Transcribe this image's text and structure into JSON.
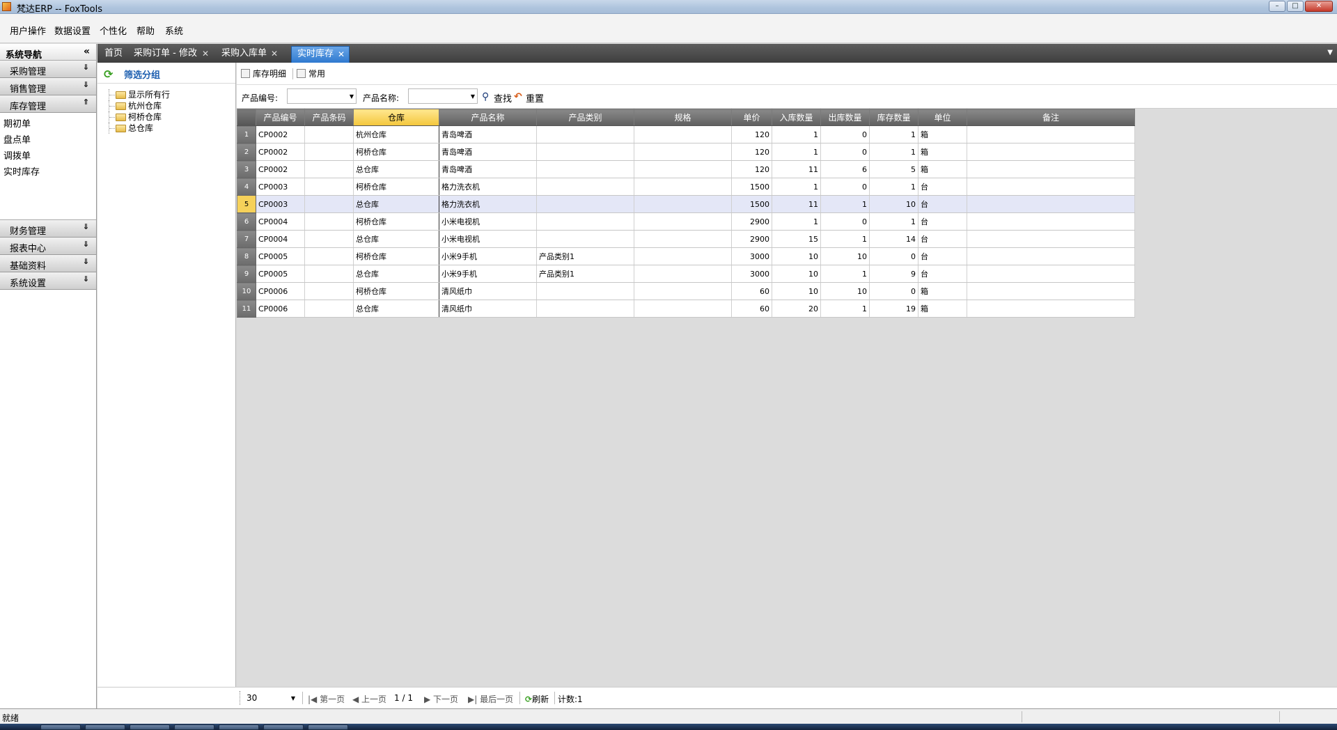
{
  "window": {
    "title": "梵达ERP -- FoxTools"
  },
  "menu": [
    "用户操作",
    "数据设置",
    "个性化",
    "帮助",
    "系统"
  ],
  "nav": {
    "header": "系统导航",
    "collapse_glyph": "«",
    "groups": [
      "采购管理",
      "销售管理",
      "库存管理"
    ],
    "sub_items": [
      "期初单",
      "盘点单",
      "调拨单",
      "实时库存"
    ],
    "groups_bottom": [
      "财务管理",
      "报表中心",
      "基础资料",
      "系统设置"
    ]
  },
  "tabs": [
    {
      "label": "首页"
    },
    {
      "label": "采购订单 - 修改"
    },
    {
      "label": "采购入库单"
    },
    {
      "label": "实时库存"
    }
  ],
  "filter": {
    "title": "筛选分组",
    "tree": [
      "显示所有行",
      "杭州仓库",
      "柯桥仓库",
      "总仓库"
    ],
    "footer_select": "常用"
  },
  "toolbar": {
    "detail": "库存明细",
    "common": "常用"
  },
  "search": {
    "code_label": "产品编号:",
    "name_label": "产品名称:",
    "search_btn": "查找",
    "reset_btn": "重置"
  },
  "grid": {
    "columns": [
      "产品编号",
      "产品条码",
      "仓库",
      "产品名称",
      "产品类别",
      "规格",
      "单价",
      "入库数量",
      "出库数量",
      "库存数量",
      "单位",
      "备注"
    ],
    "rows": [
      [
        "1",
        "CP0002",
        "",
        "杭州仓库",
        "青岛啤酒",
        "",
        "",
        "120",
        "1",
        "0",
        "1",
        "箱",
        ""
      ],
      [
        "2",
        "CP0002",
        "",
        "柯桥仓库",
        "青岛啤酒",
        "",
        "",
        "120",
        "1",
        "0",
        "1",
        "箱",
        ""
      ],
      [
        "3",
        "CP0002",
        "",
        "总仓库",
        "青岛啤酒",
        "",
        "",
        "120",
        "11",
        "6",
        "5",
        "箱",
        ""
      ],
      [
        "4",
        "CP0003",
        "",
        "柯桥仓库",
        "格力洗衣机",
        "",
        "",
        "1500",
        "1",
        "0",
        "1",
        "台",
        ""
      ],
      [
        "5",
        "CP0003",
        "",
        "总仓库",
        "格力洗衣机",
        "",
        "",
        "1500",
        "11",
        "1",
        "10",
        "台",
        ""
      ],
      [
        "6",
        "CP0004",
        "",
        "柯桥仓库",
        "小米电视机",
        "",
        "",
        "2900",
        "1",
        "0",
        "1",
        "台",
        ""
      ],
      [
        "7",
        "CP0004",
        "",
        "总仓库",
        "小米电视机",
        "",
        "",
        "2900",
        "15",
        "1",
        "14",
        "台",
        ""
      ],
      [
        "8",
        "CP0005",
        "",
        "柯桥仓库",
        "小米9手机",
        "产品类别1",
        "",
        "3000",
        "10",
        "10",
        "0",
        "台",
        ""
      ],
      [
        "9",
        "CP0005",
        "",
        "总仓库",
        "小米9手机",
        "产品类别1",
        "",
        "3000",
        "10",
        "1",
        "9",
        "台",
        ""
      ],
      [
        "10",
        "CP0006",
        "",
        "柯桥仓库",
        "清风纸巾",
        "",
        "",
        "60",
        "10",
        "10",
        "0",
        "箱",
        ""
      ],
      [
        "11",
        "CP0006",
        "",
        "总仓库",
        "清风纸巾",
        "",
        "",
        "60",
        "20",
        "1",
        "19",
        "箱",
        ""
      ]
    ]
  },
  "pager": {
    "page_size": "30",
    "first": "第一页",
    "prev": "上一页",
    "page": "1",
    "slash": "/",
    "total": "1",
    "next": "下一页",
    "last": "最后一页",
    "refresh": "刷新",
    "count": "计数:1"
  },
  "status": {
    "text": "就绪"
  },
  "colors": {
    "active_tab": "#2f79cf",
    "selected_row": "#e4e7f7",
    "sorted_header": "#f3c63b"
  }
}
